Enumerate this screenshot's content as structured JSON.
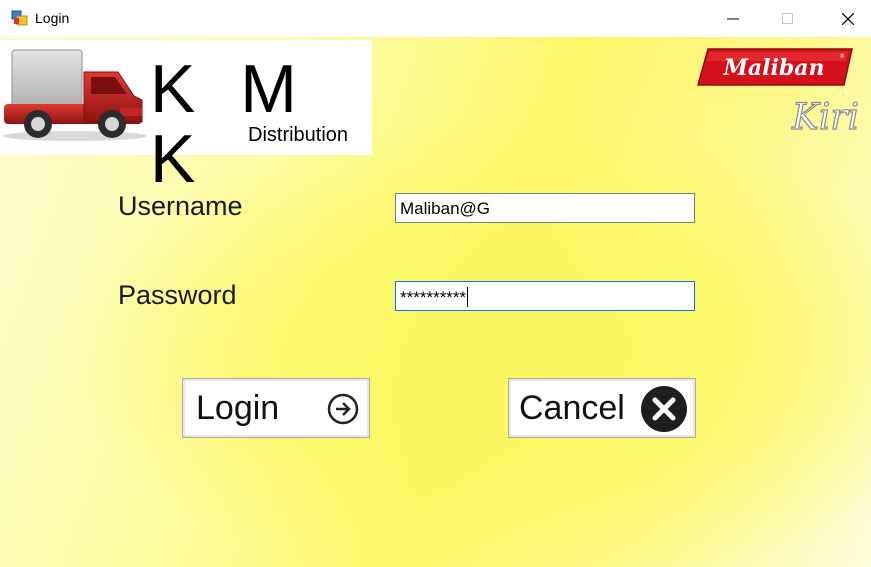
{
  "window": {
    "title": "Login",
    "icons": [
      "app-window-icon",
      "minimize-icon",
      "maximize-icon",
      "close-icon"
    ]
  },
  "branding": {
    "company_letters": "K M K",
    "company_subtitle": "Distribution",
    "partner_logo": "Maliban",
    "partner_sublogo": "Kiri",
    "colors": {
      "truck": "#b01c1c",
      "maliban_red": "#d4101a",
      "background": "#fbf760"
    }
  },
  "form": {
    "username_label": "Username",
    "username_value": "Maliban@G",
    "password_label": "Password",
    "password_value": "**********"
  },
  "buttons": {
    "login_label": "Login",
    "login_icon": "arrow-right-circle-icon",
    "cancel_label": "Cancel",
    "cancel_icon": "close-circle-icon"
  }
}
